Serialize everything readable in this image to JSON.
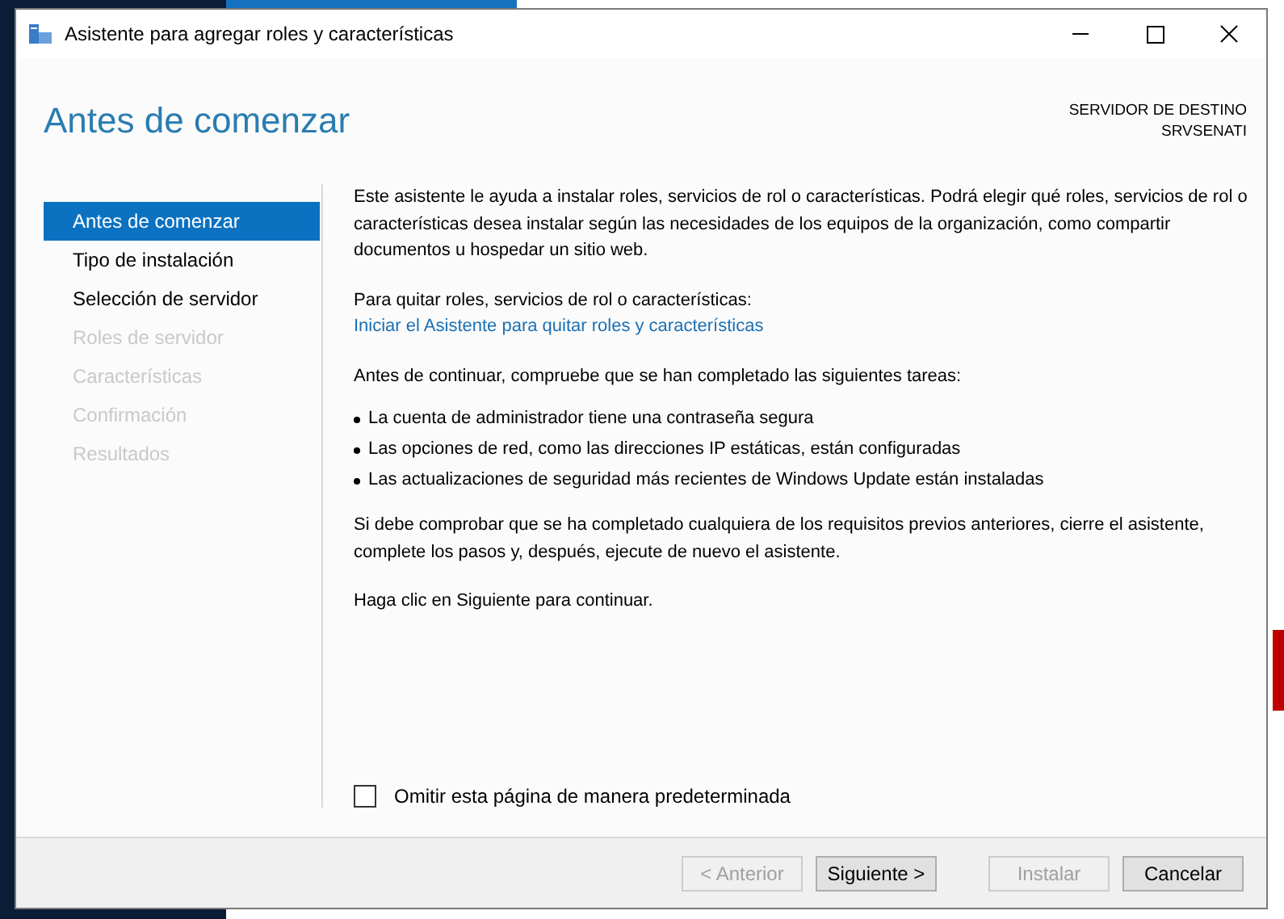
{
  "window": {
    "title": "Asistente para agregar roles y características"
  },
  "page_title": "Antes de comenzar",
  "destination": {
    "label": "SERVIDOR DE DESTINO",
    "server": "SRVSENATI"
  },
  "steps": [
    {
      "label": "Antes de comenzar",
      "selected": true,
      "disabled": false
    },
    {
      "label": "Tipo de instalación",
      "selected": false,
      "disabled": false
    },
    {
      "label": "Selección de servidor",
      "selected": false,
      "disabled": false
    },
    {
      "label": "Roles de servidor",
      "selected": false,
      "disabled": true
    },
    {
      "label": "Características",
      "selected": false,
      "disabled": true
    },
    {
      "label": "Confirmación",
      "selected": false,
      "disabled": true
    },
    {
      "label": "Resultados",
      "selected": false,
      "disabled": true
    }
  ],
  "intro": "Este asistente le ayuda a instalar roles, servicios de rol o características. Podrá elegir qué roles, servicios de rol o características desea instalar según las necesidades de los equipos de la organización, como compartir documentos u hospedar un sitio web.",
  "remove_text": "Para quitar roles, servicios de rol o características:",
  "remove_link": "Iniciar el Asistente para quitar roles y características",
  "tasks_intro": "Antes de continuar, compruebe que se han completado las siguientes tareas:",
  "tasks": [
    "La cuenta de administrador tiene una contraseña segura",
    "Las opciones de red, como las direcciones IP estáticas, están configuradas",
    "Las actualizaciones de seguridad más recientes de Windows Update están instaladas"
  ],
  "requirements_text": "Si debe comprobar que se ha completado cualquiera de los requisitos previos anteriores, cierre el asistente, complete los pasos y, después, ejecute de nuevo el asistente.",
  "next_hint": "Haga clic en Siguiente para continuar.",
  "skip_checkbox": {
    "label": "Omitir esta página de manera predeterminada",
    "checked": false
  },
  "buttons": [
    {
      "label": "< Anterior",
      "disabled": true,
      "kind": "nav"
    },
    {
      "label": "Siguiente >",
      "disabled": false,
      "kind": "nav"
    },
    {
      "label": "Instalar",
      "disabled": true,
      "kind": "action"
    },
    {
      "label": "Cancelar",
      "disabled": false,
      "kind": "action"
    }
  ]
}
